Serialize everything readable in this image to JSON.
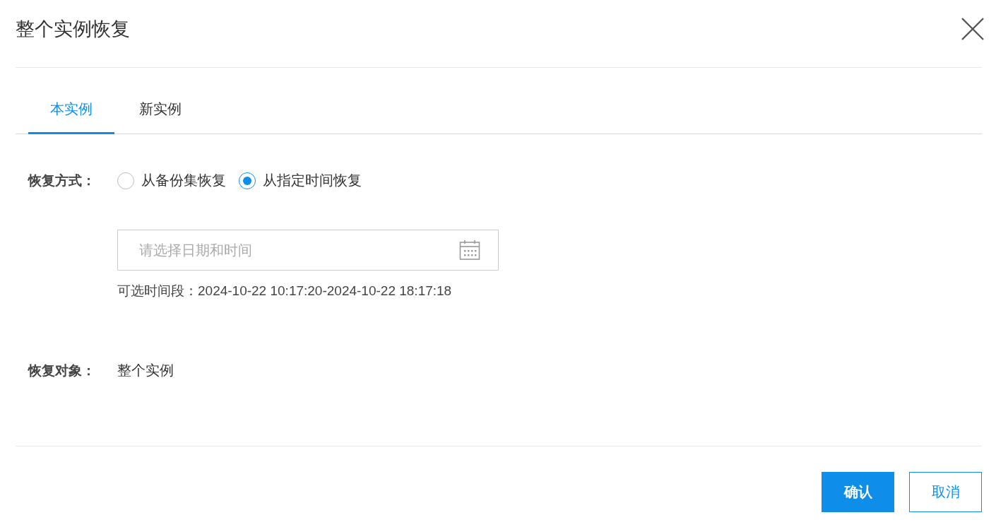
{
  "dialog": {
    "title": "整个实例恢复"
  },
  "tabs": [
    {
      "label": "本实例",
      "selected": true
    },
    {
      "label": "新实例",
      "selected": false
    }
  ],
  "restore_method": {
    "label": "恢复方式：",
    "options": [
      {
        "label": "从备份集恢复",
        "selected": false
      },
      {
        "label": "从指定时间恢复",
        "selected": true
      }
    ]
  },
  "datetime_field": {
    "placeholder": "请选择日期和时间"
  },
  "time_range": "可选时间段：2024-10-22 10:17:20-2024-10-22 18:17:18",
  "restore_target": {
    "label": "恢复对象：",
    "value": "整个实例"
  },
  "buttons": [
    {
      "label": "确认",
      "kind": "primary"
    },
    {
      "label": "取消",
      "kind": "secondary"
    }
  ]
}
